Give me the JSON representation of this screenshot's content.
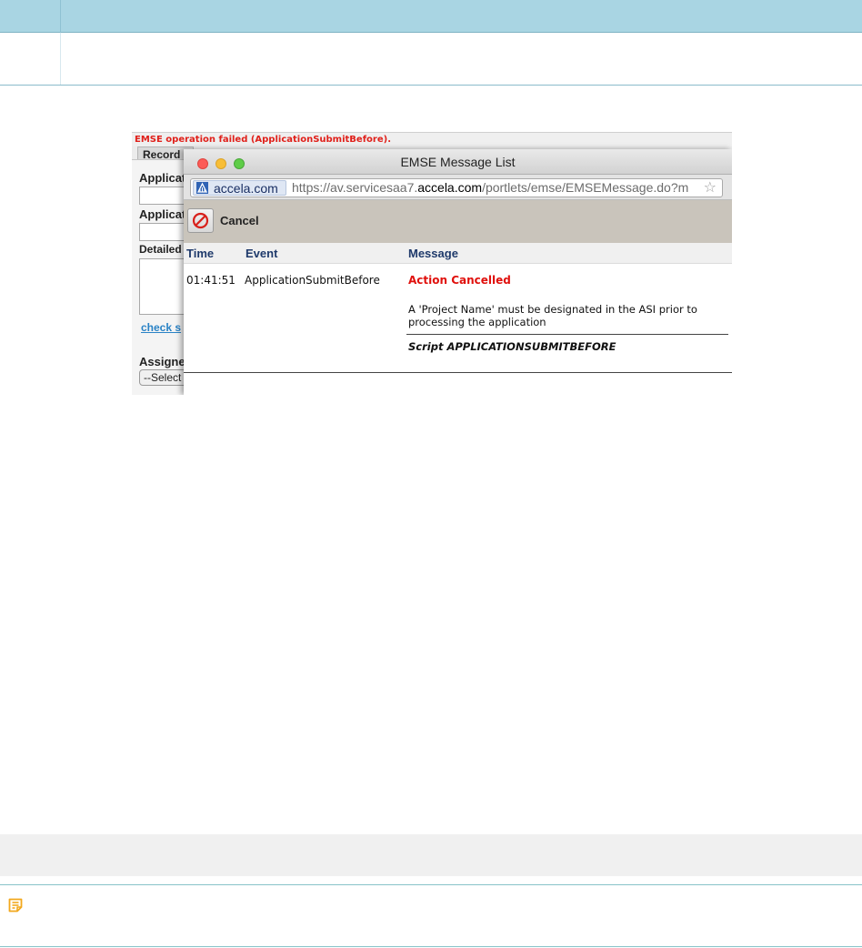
{
  "figure": {
    "error_banner": "EMSE operation failed (ApplicationSubmitBefore).",
    "background_form": {
      "tab_label": "Record",
      "fields": [
        "Applicat",
        "Applicat",
        "Detailed"
      ],
      "link_text": "check s",
      "assigned_label": "Assigne",
      "select_value": "--Select"
    },
    "popup": {
      "window_title": "EMSE Message List",
      "site_name": "accela.com",
      "url_prefix": "https://av.servicesaa7.",
      "url_domain": "accela.com",
      "url_suffix": "/portlets/emse/EMSEMessage.do?m",
      "toolbar": {
        "cancel_label": "Cancel"
      },
      "columns": {
        "time": "Time",
        "event": "Event",
        "message": "Message"
      },
      "row": {
        "time": "01:41:51",
        "event": "ApplicationSubmitBefore",
        "status": "Action Cancelled",
        "message": "A 'Project Name' must be designated in the ASI prior to processing the application",
        "script": "Script  APPLICATIONSUBMITBEFORE"
      }
    }
  },
  "colors": {
    "table_header": "#a9d5e3",
    "error_red": "#e0201a",
    "column_header_text": "#1f3a6b",
    "toolbar_bg": "#c9c4bb",
    "note_icon": "#f2a81d"
  },
  "icons": {
    "note": "note-icon",
    "cancel": "no-entry-icon",
    "bookmark": "star-icon",
    "site": "accela-logo-icon"
  }
}
